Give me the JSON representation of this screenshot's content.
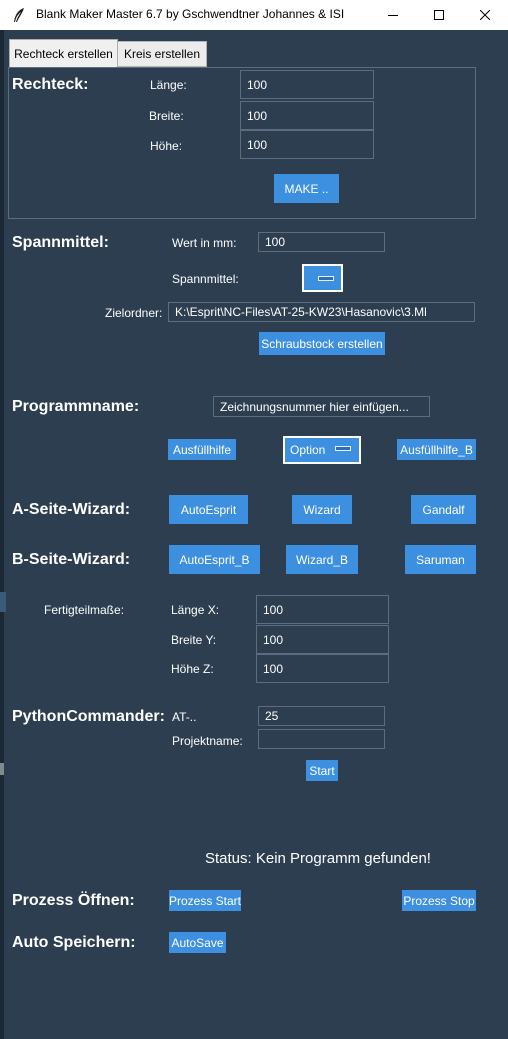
{
  "window": {
    "title": "Blank Maker Master 6.7 by Gschwendtner Johannes & ISI",
    "minimize_glyph": "–",
    "maximize_glyph": "☐",
    "close_glyph": "✕"
  },
  "tabs": [
    {
      "label": "Rechteck erstellen",
      "active": true
    },
    {
      "label": "Kreis erstellen",
      "active": false
    }
  ],
  "rechteck": {
    "heading": "Rechteck:",
    "laenge_label": "Länge:",
    "laenge_value": "100",
    "breite_label": "Breite:",
    "breite_value": "100",
    "hoehe_label": "Höhe:",
    "hoehe_value": "100",
    "make_button": "MAKE .."
  },
  "spannmittel": {
    "heading": "Spannmittel:",
    "wert_label": "Wert in mm:",
    "wert_value": "100",
    "spannmittel_label": "Spannmittel:",
    "zielordner_label": "Zielordner:",
    "zielordner_value": "K:\\Esprit\\NC-Files\\AT-25-KW23\\Hasanovic\\3.Ml",
    "schraubstock_button": "Schraubstock erstellen"
  },
  "programmname": {
    "heading": "Programmname:",
    "input_value": "Zeichnungsnummer hier einfügen...",
    "ausfuellhilfe_button": "Ausfüllhilfe",
    "option_button": "Option",
    "ausfuellhilfe_b_button": "Ausfüllhilfe_B"
  },
  "a_seite": {
    "heading": "A-Seite-Wizard:",
    "autoesprit_button": "AutoEsprit",
    "wizard_button": "Wizard",
    "gandalf_button": "Gandalf"
  },
  "b_seite": {
    "heading": "B-Seite-Wizard:",
    "autoesprit_b_button": "AutoEsprit_B",
    "wizard_b_button": "Wizard_B",
    "saruman_button": "Saruman"
  },
  "fertigteil": {
    "label": "Fertigteilmaße:",
    "laenge_x_label": "Länge X:",
    "laenge_x_value": "100",
    "breite_y_label": "Breite Y:",
    "breite_y_value": "100",
    "hoehe_z_label": "Höhe Z:",
    "hoehe_z_value": "100"
  },
  "python": {
    "heading": "PythonCommander:",
    "at_label": "AT-..",
    "at_value": "25",
    "projektname_label": "Projektname:",
    "projektname_value": "",
    "start_button": "Start"
  },
  "status": {
    "text": "Status: Kein Programm gefunden!"
  },
  "prozess": {
    "heading": "Prozess Öffnen:",
    "start_button": "Prozess Start",
    "stop_button": "Prozess Stop"
  },
  "autosave": {
    "heading": "Auto Speichern:",
    "button": "AutoSave"
  },
  "colors": {
    "background": "#2c3e50",
    "button": "#3d8fe0",
    "entry_border": "#5d6d7e",
    "text": "#ffffff"
  }
}
